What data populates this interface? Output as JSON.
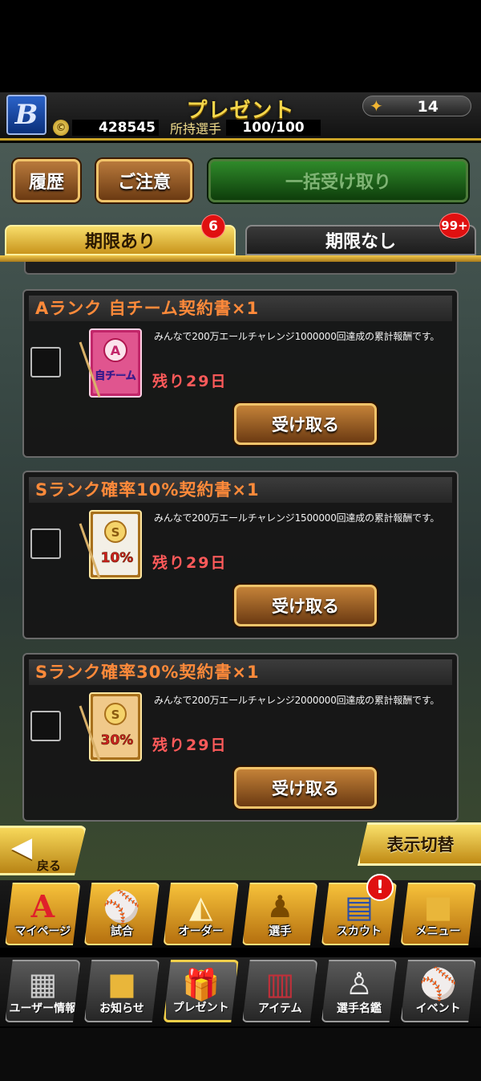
{
  "header": {
    "title": "プレゼント",
    "team_logo": "B",
    "bat_count": "14",
    "coin_icon_label": "©",
    "coins": "428545",
    "players_label": "所持選手",
    "players_value": "100/100"
  },
  "actions": {
    "history_label": "履歴",
    "notice_label": "ご注意",
    "receive_all_label": "一括受け取り"
  },
  "tabs": [
    {
      "label": "期限あり",
      "badge": "6",
      "active": true
    },
    {
      "label": "期限なし",
      "badge": "99+",
      "active": false
    }
  ],
  "presents": [
    {
      "title": "Aランク 自チーム契約書×1",
      "description": "みんなで200万エールチャレンジ1000000回達成の累計報酬です。",
      "remaining": "残り29日",
      "button_label": "受け取る",
      "icon": "team-contract-icon",
      "icon_text": "自チーム"
    },
    {
      "title": "Sランク確率10%契約書×1",
      "description": "みんなで200万エールチャレンジ1500000回達成の累計報酬です。",
      "remaining": "残り29日",
      "button_label": "受け取る",
      "icon": "s-contract-10-icon",
      "icon_text": "10%"
    },
    {
      "title": "Sランク確率30%契約書×1",
      "description": "みんなで200万エールチャレンジ2000000回達成の累計報酬です。",
      "remaining": "残り29日",
      "button_label": "受け取る",
      "icon": "s-contract-30-icon",
      "icon_text": "30%"
    }
  ],
  "nav": {
    "back_label": "戻る",
    "toggle_label": "表示切替",
    "row1": [
      {
        "label": "マイページ",
        "icon": "mypage-icon"
      },
      {
        "label": "試合",
        "icon": "match-icon"
      },
      {
        "label": "オーダー",
        "icon": "order-icon"
      },
      {
        "label": "選手",
        "icon": "player-icon"
      },
      {
        "label": "スカウト",
        "icon": "scout-icon"
      },
      {
        "label": "メニュー",
        "icon": "menu-icon"
      }
    ],
    "row2": [
      {
        "label": "ユーザー情報",
        "icon": "user-info-icon"
      },
      {
        "label": "お知らせ",
        "icon": "news-icon"
      },
      {
        "label": "プレゼント",
        "icon": "present-icon"
      },
      {
        "label": "アイテム",
        "icon": "item-icon"
      },
      {
        "label": "選手名鑑",
        "icon": "player-directory-icon"
      },
      {
        "label": "イベント",
        "icon": "event-icon"
      }
    ],
    "alert_badge": "!"
  },
  "colors": {
    "gold": "#f5d64a",
    "orange_title": "#ff8a3a",
    "remaining_red": "#ff5a5a",
    "badge_red": "#e01010"
  }
}
